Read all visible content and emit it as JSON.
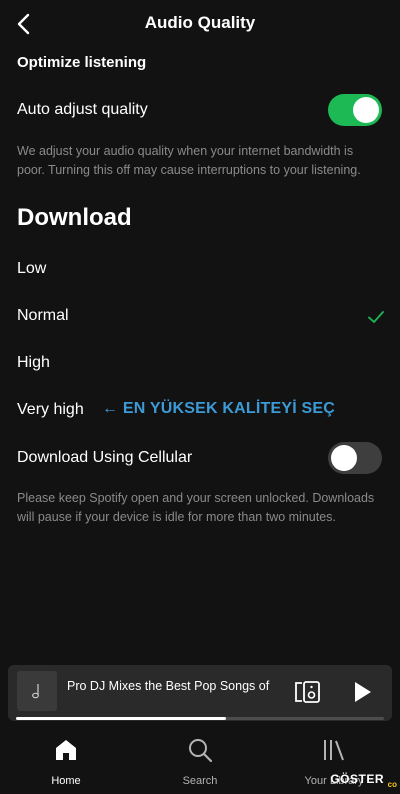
{
  "header": {
    "title": "Audio Quality"
  },
  "optimize": {
    "title": "Optimize listening",
    "auto_adjust": {
      "label": "Auto adjust quality",
      "enabled": true
    },
    "description": "We adjust your audio quality when your internet bandwidth is poor. Turning this off may cause interruptions to your listening."
  },
  "download": {
    "title": "Download",
    "options": [
      {
        "label": "Low",
        "selected": false
      },
      {
        "label": "Normal",
        "selected": true
      },
      {
        "label": "High",
        "selected": false
      },
      {
        "label": "Very high",
        "selected": false
      }
    ],
    "cellular": {
      "label": "Download Using Cellular",
      "enabled": false
    },
    "note": "Please keep Spotify open and your screen unlocked. Downloads will pause if your device is idle for more than two minutes."
  },
  "annotation": "← EN YÜKSEK KALİTEYİ SEÇ",
  "player": {
    "title": "Pro DJ Mixes the Best Pop Songs of",
    "progress": 0.57
  },
  "nav": [
    {
      "label": "Home",
      "icon": "home-icon",
      "active": true
    },
    {
      "label": "Search",
      "icon": "search-icon",
      "active": false
    },
    {
      "label": "Your Library",
      "icon": "library-icon",
      "active": false
    }
  ],
  "watermark": {
    "text": "GÖSTER",
    "sub": "co"
  },
  "colors": {
    "accent": "#1db954",
    "annotation": "#3c9ad6",
    "background": "#121212"
  }
}
